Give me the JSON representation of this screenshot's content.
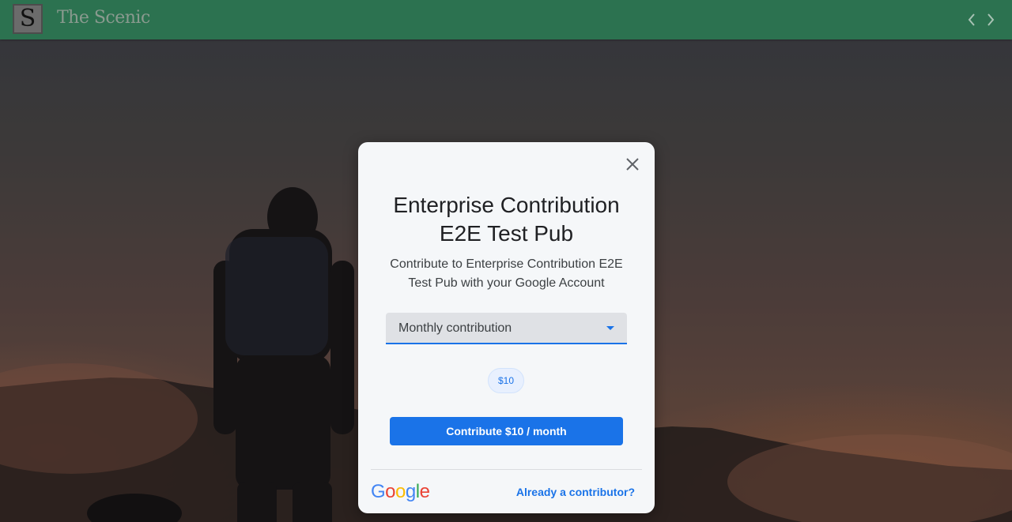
{
  "header": {
    "logo_letter": "S",
    "site_title": "The Scenic",
    "prev_icon": "chevron-left-icon",
    "next_icon": "chevron-right-icon"
  },
  "dialog": {
    "close_icon": "close-icon",
    "title": "Enterprise Contribution E2E Test Pub",
    "subtitle": "Contribute to Enterprise Contribution E2E Test Pub with your Google Account",
    "select": {
      "value": "Monthly contribution"
    },
    "amount_chip": "$10",
    "cta_label": "Contribute $10 / month",
    "footer": {
      "google_logo_text": "Google",
      "already_link": "Already a contributor?"
    }
  },
  "colors": {
    "header_bg": "#2c7250",
    "accent": "#1a73e8",
    "google_blue": "#4285f4",
    "google_red": "#ea4335",
    "google_yellow": "#fbbc05",
    "google_green": "#34a853"
  }
}
